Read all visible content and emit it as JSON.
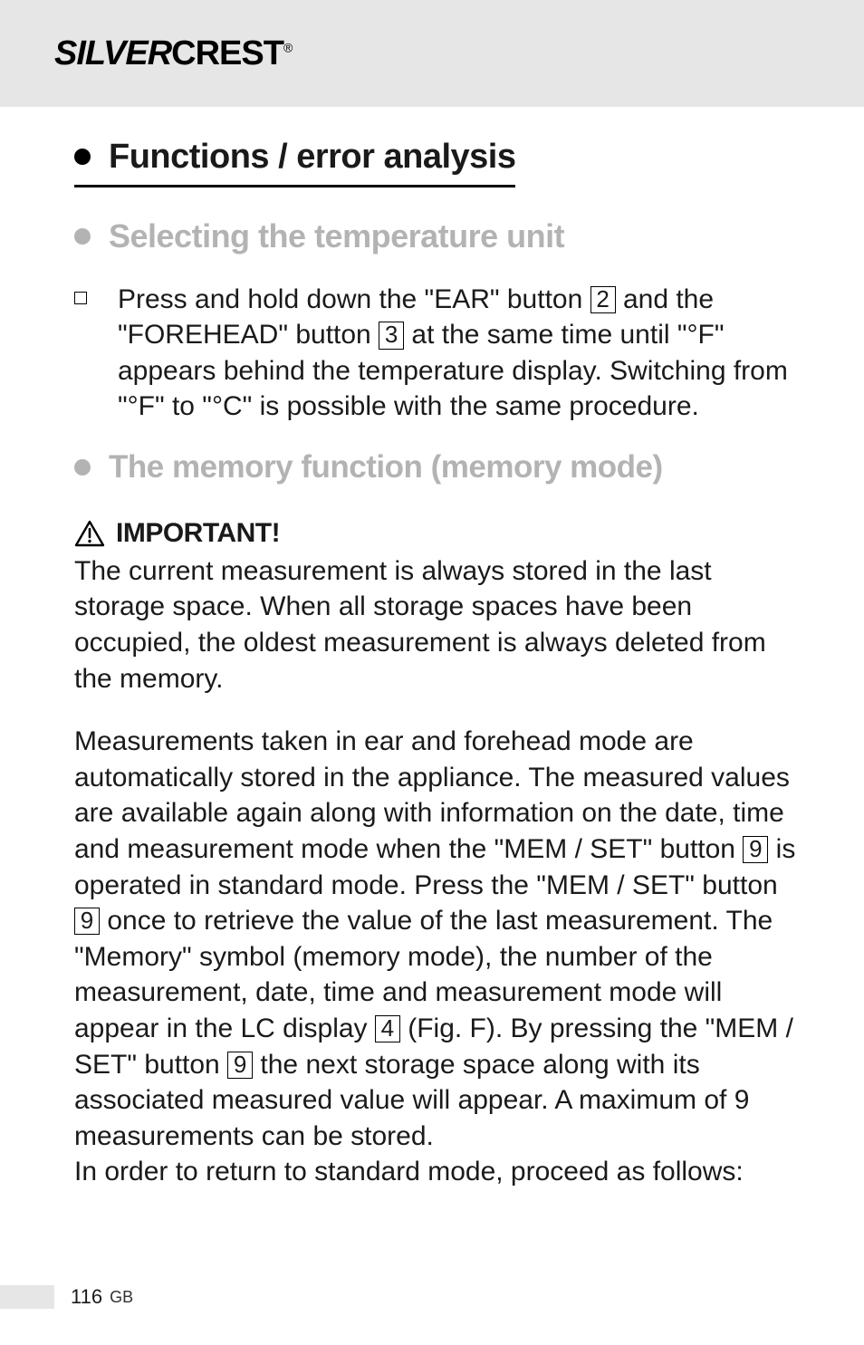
{
  "brand": {
    "part1": "SILVER",
    "part2": "CREST",
    "reg": "®"
  },
  "h1": {
    "title": "Functions / error analysis"
  },
  "h2a": {
    "title": "Selecting the temperature unit"
  },
  "instr": {
    "p1a": "Press and hold down the \"EAR\" button ",
    "k1": "2",
    "p1b": " and the \"FOREHEAD\" button ",
    "k2": "3",
    "p1c": " at the same time until \"°F\" appears behind the temperature display. Switching from \"°F\" to \"°C\" is possible with the same procedure."
  },
  "h2b": {
    "title": "The memory function (memory mode)"
  },
  "important": {
    "label": "IMPORTANT!"
  },
  "para1": "The current measurement is always stored in the last storage space. When all storage spaces have been occupied, the oldest measurement is always deleted from the memory.",
  "para2": {
    "a": "Measurements taken in ear and forehead mode are automatically stored in the appliance. The measured values are available again along with information on the date, time and measurement mode when the \"MEM / SET\" button ",
    "k1": "9",
    "b": " is operated in standard mode. Press the \"MEM / SET\" button ",
    "k2": "9",
    "c": " once to retrieve the value of the last measurement. The \"Memory\" symbol (memory mode), the number of the measurement, date, time and measurement mode will appear in the LC display ",
    "k3": "4",
    "d": " (Fig. F). By pressing the \"MEM / SET\" button ",
    "k4": "9",
    "e": " the next storage space along with its associated measured value will appear. A maximum of 9 measurements can be stored."
  },
  "para3": "In order to return to standard mode, proceed as follows:",
  "footer": {
    "page": "116",
    "country": "GB"
  }
}
